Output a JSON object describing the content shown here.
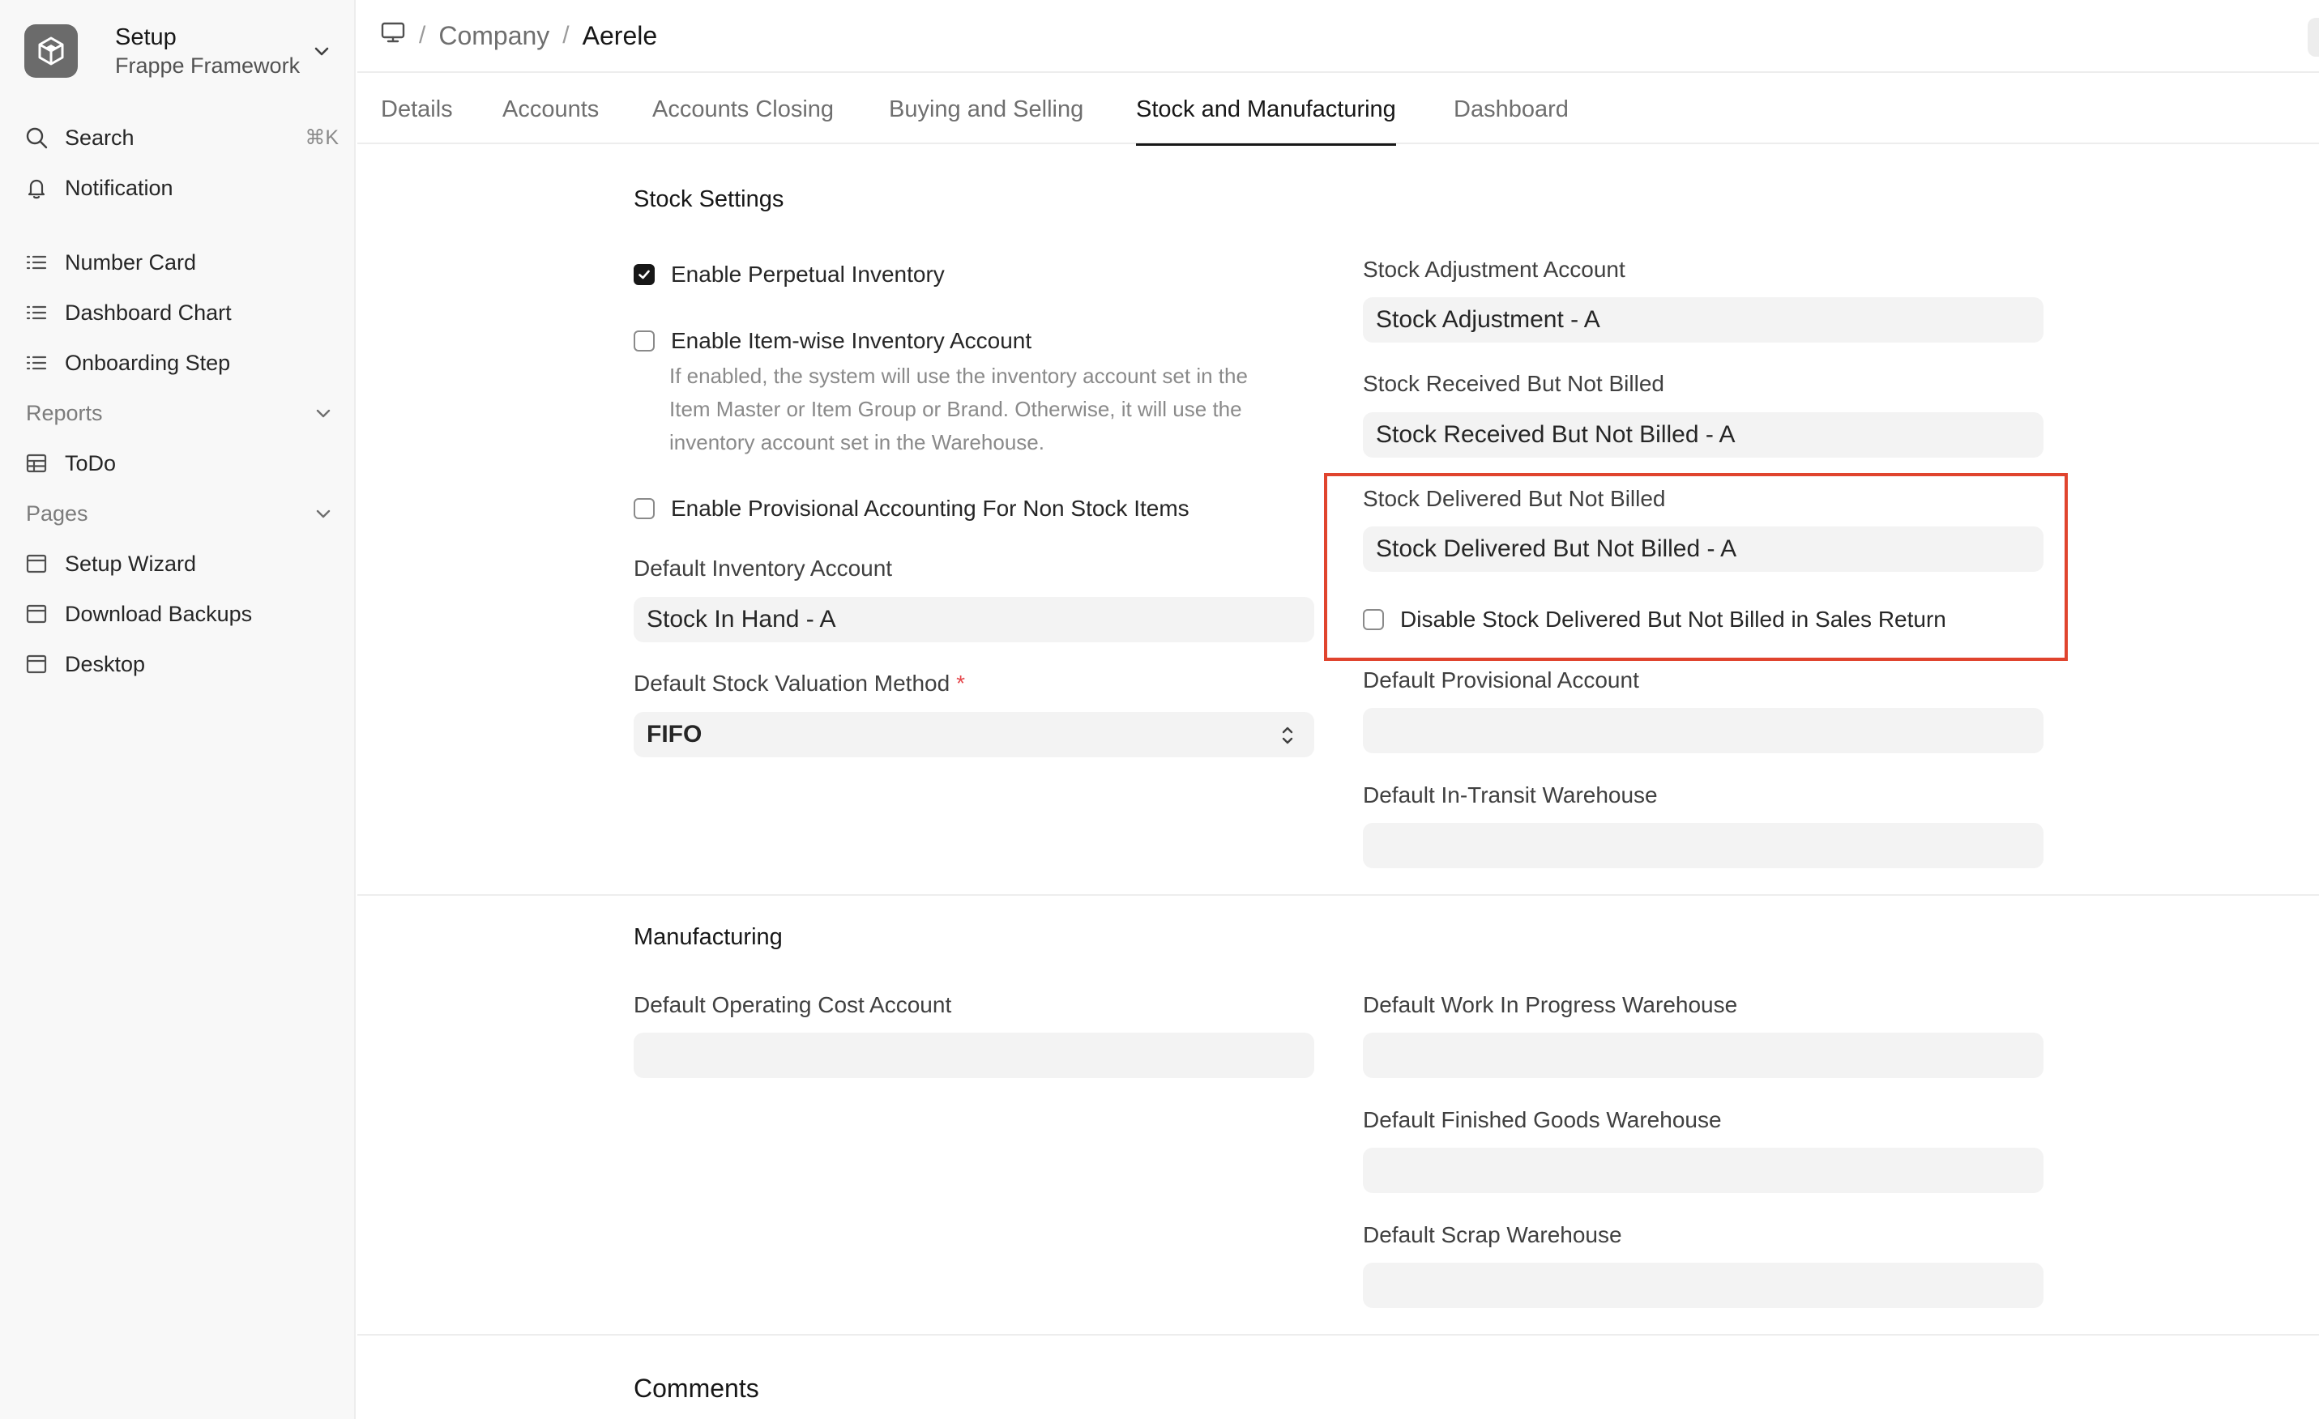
{
  "app": {
    "title": "Setup",
    "subtitle": "Frappe Framework"
  },
  "sidebar": {
    "search_label": "Search",
    "search_shortcut": "⌘K",
    "notification_label": "Notification",
    "items": [
      "Number Card",
      "Dashboard Chart",
      "Onboarding Step"
    ],
    "reports": {
      "title": "Reports",
      "items": [
        "ToDo"
      ]
    },
    "pages": {
      "title": "Pages",
      "items": [
        "Setup Wizard",
        "Download Backups",
        "Desktop"
      ]
    }
  },
  "breadcrumb": {
    "parent": "Company",
    "current": "Aerele"
  },
  "tabs": [
    "Details",
    "Accounts",
    "Accounts Closing",
    "Buying and Selling",
    "Stock and Manufacturing",
    "Dashboard"
  ],
  "active_tab": "Stock and Manufacturing",
  "stock_settings": {
    "title": "Stock Settings",
    "enable_perpetual_inventory": {
      "label": "Enable Perpetual Inventory",
      "checked": true
    },
    "enable_item_wise": {
      "label": "Enable Item-wise Inventory Account",
      "checked": false,
      "help": [
        "If enabled, the system will use the inventory account set in the",
        "Item Master or Item Group or Brand. Otherwise, it will use the",
        "inventory account set in the Warehouse."
      ]
    },
    "enable_provisional": {
      "label": "Enable Provisional Accounting For Non Stock Items",
      "checked": false
    },
    "default_inventory_account": {
      "label": "Default Inventory Account",
      "value": "Stock In Hand - A"
    },
    "default_stock_valuation_method": {
      "label": "Default Stock Valuation Method",
      "required_mark": "*",
      "value": "FIFO"
    },
    "stock_adjustment_account": {
      "label": "Stock Adjustment Account",
      "value": "Stock Adjustment - A"
    },
    "stock_received_but_not_billed": {
      "label": "Stock Received But Not Billed",
      "value": "Stock Received But Not Billed - A"
    },
    "stock_delivered_but_not_billed": {
      "label": "Stock Delivered But Not Billed",
      "value": "Stock Delivered But Not Billed - A"
    },
    "disable_sdbnb_sales_return": {
      "label": "Disable Stock Delivered But Not Billed in Sales Return",
      "checked": false
    },
    "default_provisional_account": {
      "label": "Default Provisional Account",
      "value": ""
    },
    "default_in_transit_warehouse": {
      "label": "Default In-Transit Warehouse",
      "value": ""
    }
  },
  "manufacturing": {
    "title": "Manufacturing",
    "default_operating_cost_account": {
      "label": "Default Operating Cost Account",
      "value": ""
    },
    "default_wip_warehouse": {
      "label": "Default Work In Progress Warehouse",
      "value": ""
    },
    "default_finished_goods_warehouse": {
      "label": "Default Finished Goods Warehouse",
      "value": ""
    },
    "default_scrap_warehouse": {
      "label": "Default Scrap Warehouse",
      "value": ""
    }
  },
  "comments": {
    "title": "Comments"
  },
  "colors": {
    "highlight": "#e0442e",
    "accent": "#171717",
    "input_bg": "#f3f3f3"
  }
}
